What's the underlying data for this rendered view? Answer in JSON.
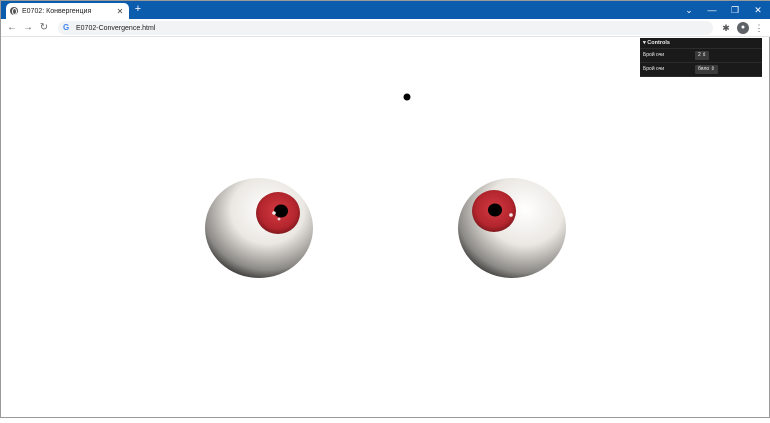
{
  "browser": {
    "tab_title": "E0702: Конвергенция",
    "tab_close": "✕",
    "new_tab": "+",
    "url": "E0702-Convergence.html",
    "window_controls": [
      "⌄",
      "—",
      "❐",
      "✕"
    ]
  },
  "controls": {
    "header": "Controls",
    "rows": [
      {
        "label": "Брой очи",
        "value": "2"
      },
      {
        "label": "Брой очи",
        "value": "бяло"
      }
    ]
  },
  "scene": {
    "background": "#ffffff",
    "target_color": "#000000",
    "iris_color": "#b3252d",
    "sclera_color": "#f0eeea",
    "eye_count": 2
  }
}
